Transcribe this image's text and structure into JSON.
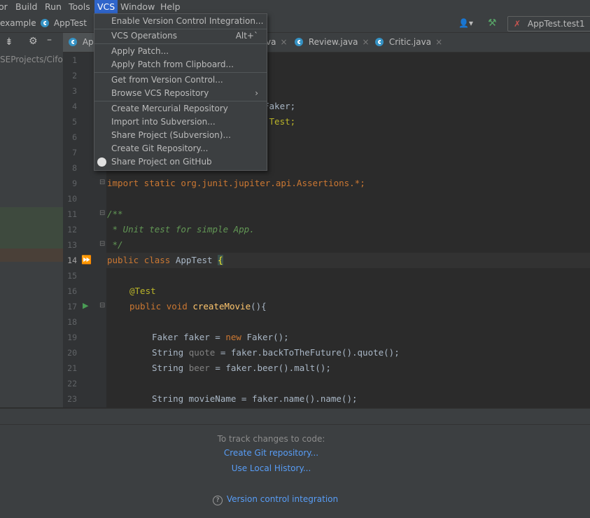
{
  "menubar": {
    "items": [
      {
        "label": "or"
      },
      {
        "label": "Build"
      },
      {
        "label": "Run"
      },
      {
        "label": "Tools"
      },
      {
        "label": "VCS"
      },
      {
        "label": "Window"
      },
      {
        "label": "Help"
      }
    ]
  },
  "navbar": {
    "crumbs": [
      "example",
      "AppTest"
    ],
    "run_config": "AppTest.test1"
  },
  "sidebar": {
    "path_text": "SEProjects/Cifo..."
  },
  "tabs": [
    {
      "label": "App"
    },
    {
      "label": "va"
    },
    {
      "label": "Review.java"
    },
    {
      "label": "Critic.java"
    }
  ],
  "vcs_menu": {
    "items": [
      {
        "label": "Enable Version Control Integration...",
        "shortcut": ""
      },
      {
        "label": "VCS Operations",
        "shortcut": "Alt+`"
      },
      {
        "label": "Apply Patch...",
        "shortcut": ""
      },
      {
        "label": "Apply Patch from Clipboard...",
        "shortcut": ""
      },
      {
        "label": "Get from Version Control...",
        "shortcut": ""
      },
      {
        "label": "Browse VCS Repository",
        "shortcut": ""
      },
      {
        "label": "Create Mercurial Repository",
        "shortcut": ""
      },
      {
        "label": "Import into Subversion...",
        "shortcut": ""
      },
      {
        "label": "Share Project (Subversion)...",
        "shortcut": ""
      },
      {
        "label": "Create Git Repository...",
        "shortcut": ""
      },
      {
        "label": "Share Project on GitHub",
        "shortcut": ""
      }
    ]
  },
  "editor": {
    "line_numbers": [
      "1",
      "2",
      "3",
      "4",
      "5",
      "6",
      "7",
      "8",
      "9",
      "10",
      "11",
      "12",
      "13",
      "14",
      "15",
      "16",
      "17",
      "18",
      "19",
      "20",
      "21",
      "22",
      "23"
    ],
    "visible_partial": {
      "line4": "Faker;",
      "line5": ".Test;"
    },
    "lines": {
      "l9": "import static org.junit.jupiter.api.Assertions.*;",
      "l11": "/**",
      "l12": " * Unit test for simple App.",
      "l13": " */",
      "l14_kw1": "public",
      "l14_kw2": "class",
      "l14_name": "AppTest",
      "l14_brace": "{",
      "l16": "@Test",
      "l17_kw1": "public",
      "l17_kw2": "void",
      "l17_fn": "createMovie",
      "l17_rest": "(){",
      "l19_a": "Faker faker = ",
      "l19_kw": "new",
      "l19_b": " Faker();",
      "l20_a": "String ",
      "l20_var": "quote",
      "l20_b": " = faker.backToTheFuture().quote();",
      "l21_a": "String ",
      "l21_var": "beer",
      "l21_b": " = faker.beer().malt();",
      "l23": "String movieName = faker.name().name();"
    }
  },
  "bottom_panel": {
    "info": "To track changes to code:",
    "link1": "Create Git repository...",
    "link2": "Use Local History...",
    "help_link": "Version control integration"
  },
  "colors": {
    "menu_highlight": "#2f65ca",
    "link": "#589df6",
    "keyword": "#cc7832",
    "comment": "#629755"
  }
}
